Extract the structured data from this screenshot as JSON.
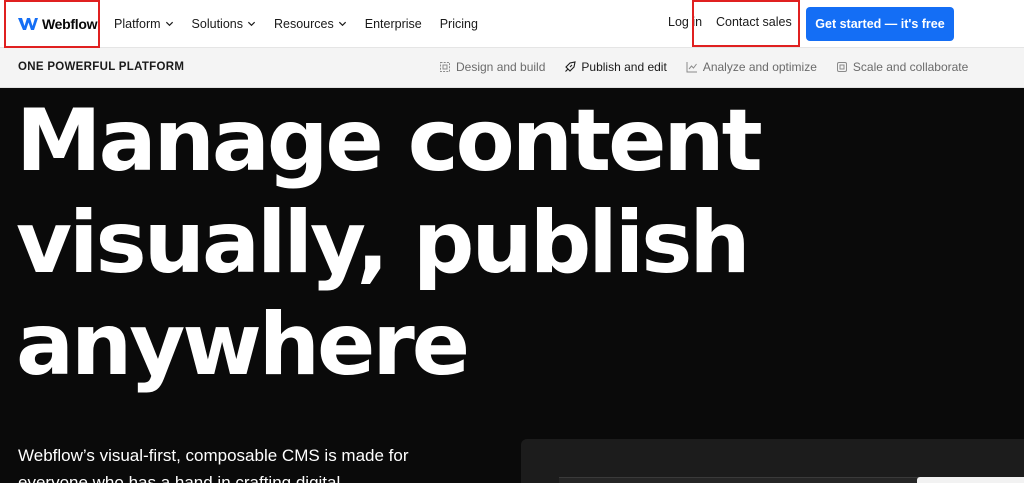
{
  "brand": {
    "name": "Webflow",
    "logo_icon": "webflow-w-logo-icon",
    "color": "#146ef5"
  },
  "nav": {
    "items": [
      {
        "label": "Platform",
        "has_dropdown": true
      },
      {
        "label": "Solutions",
        "has_dropdown": true
      },
      {
        "label": "Resources",
        "has_dropdown": true
      },
      {
        "label": "Enterprise",
        "has_dropdown": false
      },
      {
        "label": "Pricing",
        "has_dropdown": false
      }
    ],
    "login_label": "Log in",
    "contact_label": "Contact sales",
    "cta_label": "Get started — it's free"
  },
  "subnav": {
    "title": "ONE POWERFUL PLATFORM",
    "tabs": [
      {
        "label": "Design and build",
        "icon": "design-icon",
        "active": false
      },
      {
        "label": "Publish and edit",
        "icon": "publish-icon",
        "active": true
      },
      {
        "label": "Analyze and optimize",
        "icon": "analytics-icon",
        "active": false
      },
      {
        "label": "Scale and collaborate",
        "icon": "scale-icon",
        "active": false
      }
    ]
  },
  "hero": {
    "title_lines": [
      "Manage content",
      "visually, publish",
      "anywhere"
    ],
    "description": "Webflow’s visual-first, composable CMS is made for everyone who has a hand in crafting digital"
  },
  "colors": {
    "hero_bg": "#0a0a0a",
    "annotation": "#e02020"
  }
}
